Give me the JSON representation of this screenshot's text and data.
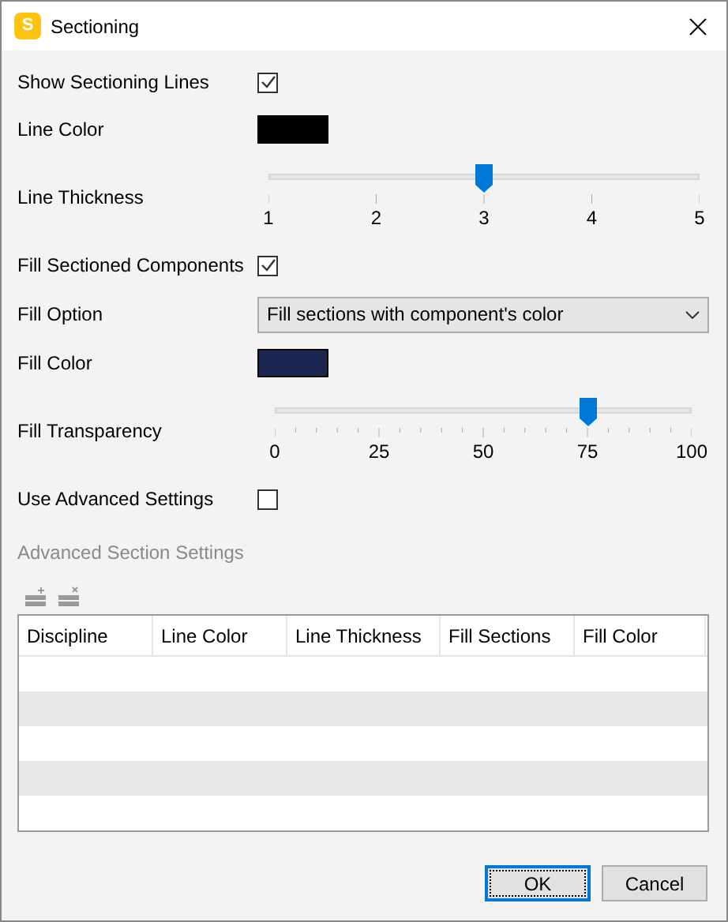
{
  "window": {
    "title": "Sectioning",
    "app_icon_letter": "S"
  },
  "settings": [
    {
      "kind": "checkbox",
      "label": "Show Sectioning Lines",
      "checked": true
    },
    {
      "kind": "color",
      "label": "Line Color",
      "color": "#000000"
    },
    {
      "kind": "slider",
      "label": "Line Thickness",
      "level": 0.5,
      "ticks": [
        "1",
        "2",
        "3",
        "4",
        "5"
      ],
      "minor_ticks": false
    },
    {
      "kind": "checkbox",
      "label": "Fill Sectioned Components",
      "checked": true
    },
    {
      "kind": "dropdown",
      "label": "Fill Option",
      "value": "Fill sections with component's color"
    },
    {
      "kind": "color",
      "label": "Fill Color",
      "color": "#1a2550"
    },
    {
      "kind": "slider",
      "label": "Fill Transparency",
      "level": 0.75,
      "ticks": [
        "0",
        "25",
        "50",
        "75",
        "100"
      ],
      "minor_ticks": true
    },
    {
      "kind": "checkbox",
      "label": "Use Advanced Settings",
      "checked": false
    }
  ],
  "advanced": {
    "title": "Advanced Section Settings",
    "disabled": true,
    "table": {
      "columns": [
        "Discipline",
        "Line Color",
        "Line Thickness",
        "Fill Sections",
        "Fill Color"
      ]
    }
  },
  "buttons": [
    {
      "label": "OK",
      "default": true
    },
    {
      "label": "Cancel",
      "default": false
    }
  ]
}
